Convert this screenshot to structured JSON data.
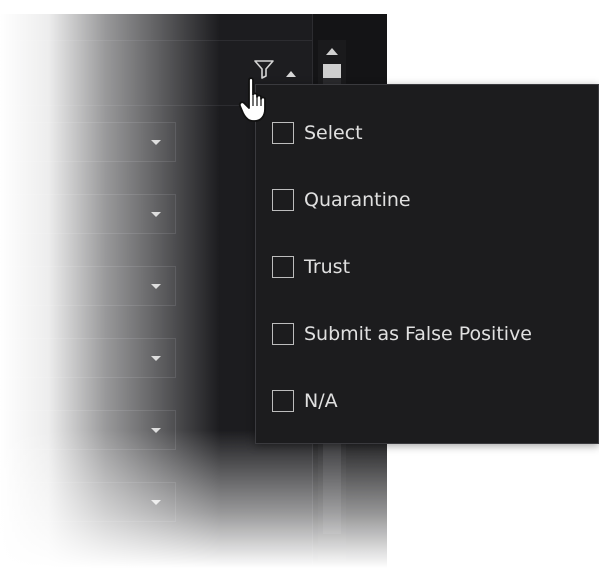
{
  "filter_menu": {
    "options": [
      {
        "label": "Select",
        "checked": false
      },
      {
        "label": "Quarantine",
        "checked": false
      },
      {
        "label": "Trust",
        "checked": false
      },
      {
        "label": "Submit as False Positive",
        "checked": false
      },
      {
        "label": "N/A",
        "checked": false
      }
    ]
  },
  "table": {
    "action_dropdown_count": 6
  },
  "icons": {
    "filter": "filter-icon",
    "sort": "sort-ascending-icon",
    "cursor": "hand-pointer-cursor",
    "scroll_up": "scroll-up-arrow",
    "dropdown_arrow": "chevron-down-icon"
  },
  "colors": {
    "panel_bg": "#1c1c1f",
    "popup_bg": "#1c1c1e",
    "text": "#e0e0e0",
    "checkbox_border": "#bdbdbd"
  }
}
